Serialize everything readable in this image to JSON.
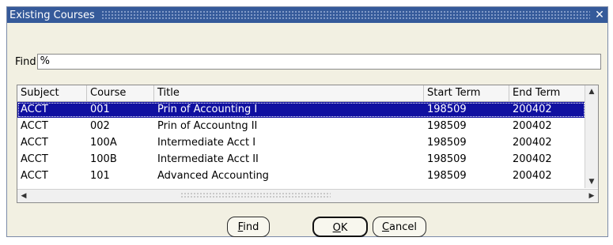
{
  "window": {
    "title": "Existing Courses",
    "close_glyph": "✕"
  },
  "find": {
    "label": "Find",
    "value": "%"
  },
  "table": {
    "columns": [
      "Subject",
      "Course",
      "Title",
      "Start Term",
      "End Term"
    ],
    "rows": [
      [
        "ACCT",
        "001",
        "Prin of Accounting I",
        "198509",
        "200402"
      ],
      [
        "ACCT",
        "002",
        "Prin of Accountng II",
        "198509",
        "200402"
      ],
      [
        "ACCT",
        "100A",
        "Intermediate Acct I",
        "198509",
        "200402"
      ],
      [
        "ACCT",
        "100B",
        "Intermediate Acct II",
        "198509",
        "200402"
      ],
      [
        "ACCT",
        "101",
        "Advanced Accounting",
        "198509",
        "200402"
      ]
    ],
    "selected_row": 0
  },
  "buttons": {
    "find": {
      "mnemonic": "F",
      "rest": "ind"
    },
    "ok": {
      "mnemonic": "O",
      "rest": "K"
    },
    "cancel": {
      "mnemonic": "C",
      "rest": "ancel"
    }
  },
  "colors": {
    "titlebar": "#355a9a",
    "dialog_bg": "#f2f0e2",
    "selection": "#1010a0"
  }
}
